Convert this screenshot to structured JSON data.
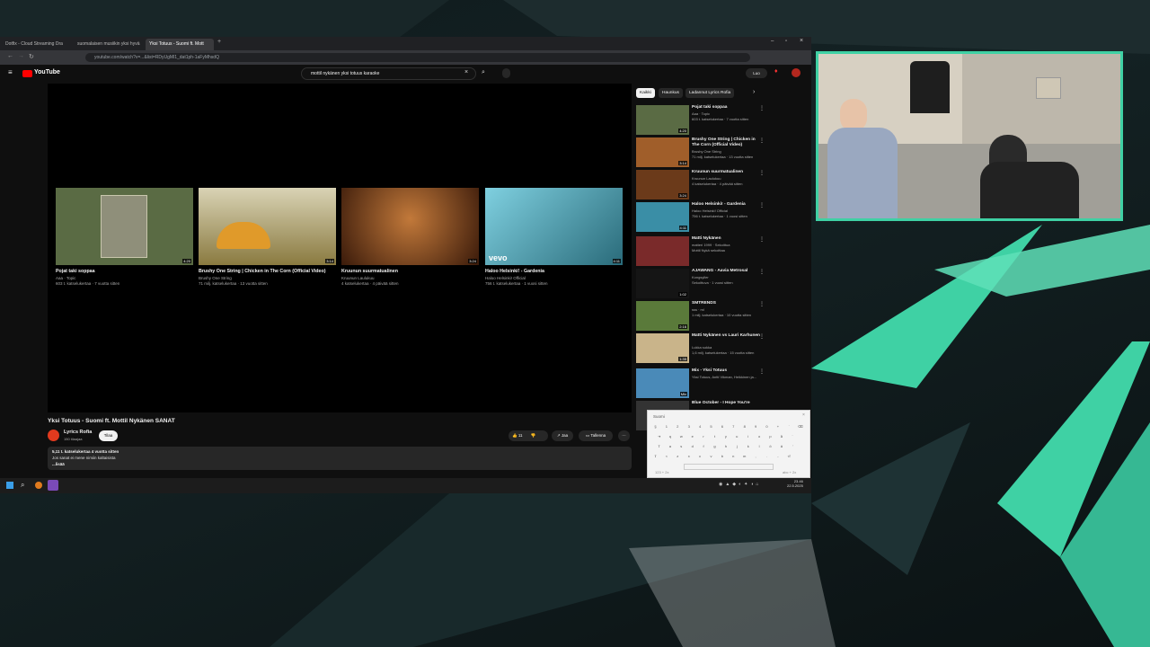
{
  "browser": {
    "tabs": [
      {
        "label": "Dotfix - Cloud Streaming Dra"
      },
      {
        "label": "suomalaisen musiikin yksi hyvä"
      },
      {
        "label": "Yksi Totuus - Suomi ft. Mott"
      }
    ],
    "url": "youtube.com/watch?v=...&list=RDyUgMl1_dat1ph-1aFyMhsdQ"
  },
  "youtube": {
    "logo": "YouTube",
    "search_query": "mottil nykänen yksi totuus karaoke",
    "create_label": "Luo",
    "end_screen": [
      {
        "title": "Pojat taki soppaa",
        "channel": "Aaa · Topic",
        "stats": "603 t. katselukertaa · 7 vuotta sitten",
        "duration": "4:20",
        "thumb_color": "#5a6b44"
      },
      {
        "title": "Brushy One String | Chicken in The Corn (Official Video)",
        "channel": "Brushy One String",
        "stats": "71 milj. katselukertaa · 13 vuotta sitten",
        "duration": "3:14",
        "thumb_color": "#8a7a40"
      },
      {
        "title": "Kruunun suurmatualinen",
        "channel": "Kruunun Laulukuu",
        "stats": "4 katselukertaa · 4 päivää sitten",
        "duration": "3:24",
        "thumb_color": "#6b3a1a"
      },
      {
        "title": "Haloo Helsinki! - Gardenia",
        "channel": "Haloo Helsinki! Official",
        "stats": "756 t. katselukertaa · 1 vuosi sitten",
        "duration": "4:11",
        "thumb_color": "#3a8ea6",
        "badge": "vevo"
      }
    ],
    "video": {
      "title": "Yksi Totuus - Suomi ft. Mottil Nykänen SANAT",
      "channel_name": "Lyrics Rofia",
      "subscribers": "150 tilaajaa",
      "subscribe_label": "Tilaa",
      "likes": "11",
      "share_label": "Jaa",
      "save_label": "Tallenna",
      "description_line1": "5,11 t. katselukertaa  4 vuotta sitten",
      "description_line2": "Jos sanat ei mene nimiin kaltaisista",
      "description_more": "...lisää"
    },
    "chips": [
      {
        "label": "Kaikki",
        "selected": true
      },
      {
        "label": "Haunkus",
        "selected": false
      },
      {
        "label": "Ladannut Lyrics Rofia",
        "selected": false
      }
    ],
    "recommendations": [
      {
        "title": "Pojat taki soppaa",
        "meta1": "Aaa · Topic",
        "meta2": "603 t. katselukertaa · 7 vuotta sitten",
        "duration": "4:20",
        "thumb_color": "#5a6b44"
      },
      {
        "title": "Brushy One String | Chicken in The Corn (Official Video)",
        "meta1": "Brushy One String",
        "meta2": "71 milj. katselukertaa · 13 vuotta sitten",
        "duration": "3:14",
        "thumb_color": "#a05e2a"
      },
      {
        "title": "Kruunun suurmatualinen",
        "meta1": "Kruunun Laulukuu",
        "meta2": "4 katselukertaa · 4 päivää sitten",
        "duration": "3:24",
        "thumb_color": "#6b3a1a"
      },
      {
        "title": "Haloo Helsinki! - Gardenia",
        "meta1": "Haloo Helsinki! Official",
        "meta2": "756 t. katselukertaa · 1 vuosi sitten",
        "duration": "4:11",
        "thumb_color": "#3a8ea6"
      },
      {
        "title": "Matti Nykänen",
        "meta1": "matteri 1999 · Sekoittua",
        "meta2": "Mottil Nykä sekoittaa",
        "duration": "",
        "thumb_color": "#7a2a2a"
      },
      {
        "title": "AJAWANG - Aavia Metrosal",
        "meta1": "Kongsyller",
        "meta2": "Sekoittuva · 1 vuosi sitten",
        "duration": "1:02",
        "thumb_color": "#151515"
      },
      {
        "title": "SMTRENDS",
        "meta1": "sss · ml",
        "meta2": "1 milj. katselukertaa · 10 vuotta sitten",
        "duration": "2:16",
        "thumb_color": "#5a7a3a"
      },
      {
        "title": "Matti Nykänen vs Lauri Karhunen",
        "meta1": "Lukka sukka",
        "meta2": "1,6 milj. katselukertaa · 15 vuotta sitten",
        "duration": "1:35",
        "thumb_color": "#c9b48a"
      },
      {
        "title": "Mix - Yksi Totuus",
        "meta1": "Yksi Totuus, Antti Vikman, Heikkinen ja...",
        "meta2": "",
        "duration": "Mix",
        "thumb_color": "#4a8ab8"
      },
      {
        "title": "Blue October - I Hope You're",
        "meta1": "",
        "meta2": "",
        "duration": "",
        "thumb_color": "#333"
      }
    ]
  },
  "keyboard": {
    "title": "Suomi",
    "row1": [
      "§",
      "1",
      "2",
      "3",
      "4",
      "5",
      "6",
      "7",
      "8",
      "9",
      "0",
      "+",
      "´",
      "⌫"
    ],
    "row2": [
      "⇥",
      "q",
      "w",
      "e",
      "r",
      "t",
      "y",
      "u",
      "i",
      "o",
      "p",
      "å",
      "¨"
    ],
    "row3": [
      "⇪",
      "a",
      "s",
      "d",
      "f",
      "g",
      "h",
      "j",
      "k",
      "l",
      "ö",
      "ä",
      "'"
    ],
    "row4": [
      "⇧",
      "<",
      "z",
      "x",
      "c",
      "v",
      "b",
      "n",
      "m",
      ",",
      ".",
      "-",
      "⏎"
    ],
    "footer_left": "123 + 2x",
    "footer_right": "abc + 2x"
  },
  "taskbar": {
    "time": "23.46",
    "date": "22.5.2025"
  },
  "colors": {
    "webcam_border": "#3fd1a4",
    "accent_shard": "#3fd1a4",
    "youtube_red": "#ff0000"
  }
}
